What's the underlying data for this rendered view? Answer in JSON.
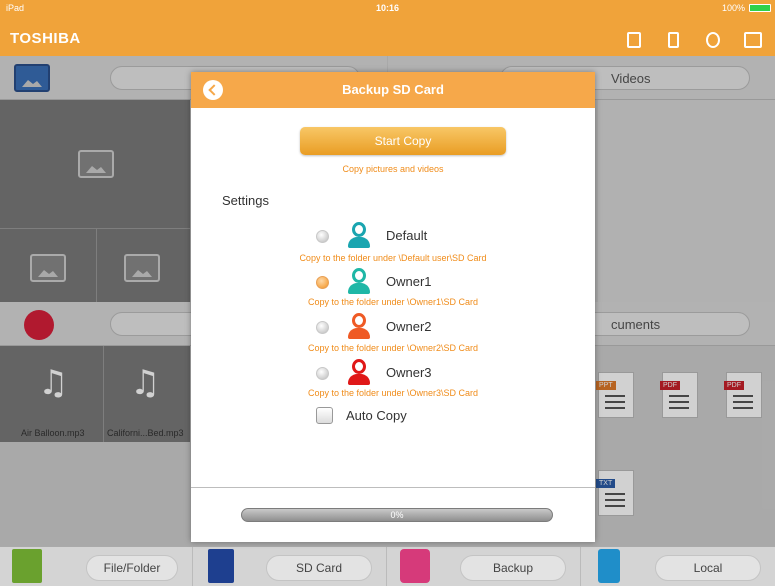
{
  "status_bar": {
    "device": "iPad",
    "time": "10:16",
    "battery": "100%"
  },
  "header": {
    "brand": "TOSHIBA"
  },
  "background": {
    "videos_label": "Videos",
    "documents_label": "cuments",
    "music_files": [
      "Air Balloon.mp3",
      "Californi...Bed.mp3"
    ],
    "doc_tags": [
      "PPT",
      "PDF",
      "PDF",
      "TXT"
    ]
  },
  "modal": {
    "title": "Backup SD Card",
    "start_button": "Start Copy",
    "start_hint": "Copy pictures and videos",
    "settings_label": "Settings",
    "options": [
      {
        "label": "Default",
        "hint": "Copy to the folder under \\Default user\\SD Card",
        "selected": false,
        "color": "#1aa5b0"
      },
      {
        "label": "Owner1",
        "hint": "Copy to the folder under \\Owner1\\SD Card",
        "selected": true,
        "color": "#1fb7a6"
      },
      {
        "label": "Owner2",
        "hint": "Copy to the folder under \\Owner2\\SD Card",
        "selected": false,
        "color": "#ef5a25"
      },
      {
        "label": "Owner3",
        "hint": "Copy to the folder under \\Owner3\\SD Card",
        "selected": false,
        "color": "#e01818"
      }
    ],
    "auto_copy_label": "Auto Copy",
    "auto_copy_checked": false,
    "progress_text": "0%",
    "progress_value": 0
  },
  "tabbar": {
    "tabs": [
      {
        "label": "File/Folder",
        "icon": "folder-icon"
      },
      {
        "label": "SD Card",
        "icon": "sd-card-icon"
      },
      {
        "label": "Backup",
        "icon": "backup-icon"
      },
      {
        "label": "Local",
        "icon": "phone-icon"
      }
    ]
  },
  "colors": {
    "accent": "#f6a84a",
    "hint": "#f08c1a",
    "header": "#f0a33a"
  }
}
